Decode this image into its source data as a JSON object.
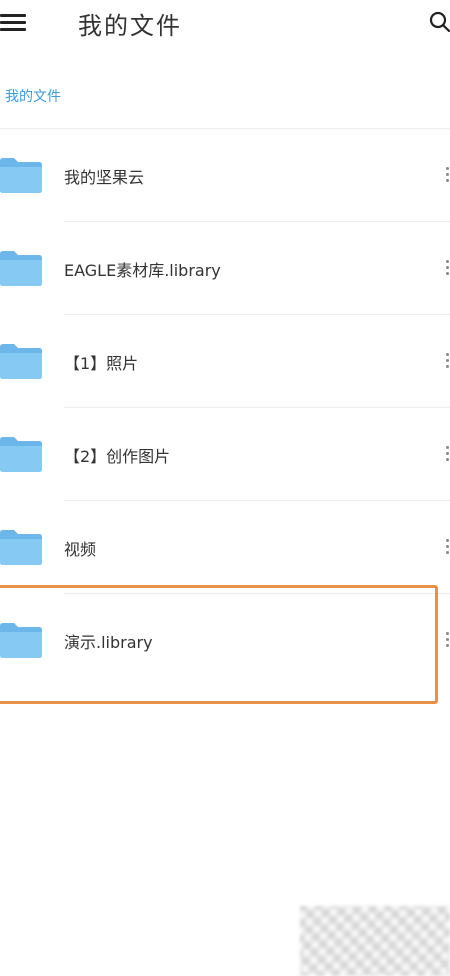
{
  "header": {
    "title": "我的文件",
    "menu_icon": "hamburger-menu-icon",
    "search_icon": "search-icon"
  },
  "breadcrumb": "我的文件",
  "files": [
    {
      "name": "我的坚果云",
      "icon": "folder-icon"
    },
    {
      "name": "EAGLE素材库.library",
      "icon": "folder-icon"
    },
    {
      "name": "【1】照片",
      "icon": "folder-icon"
    },
    {
      "name": "【2】创作图片",
      "icon": "folder-icon"
    },
    {
      "name": "视频",
      "icon": "folder-icon"
    },
    {
      "name": "演示.library",
      "icon": "folder-icon"
    }
  ],
  "colors": {
    "accent": "#3d9bd5",
    "folder": "#7fc4f2",
    "highlight": "#e8914a"
  }
}
